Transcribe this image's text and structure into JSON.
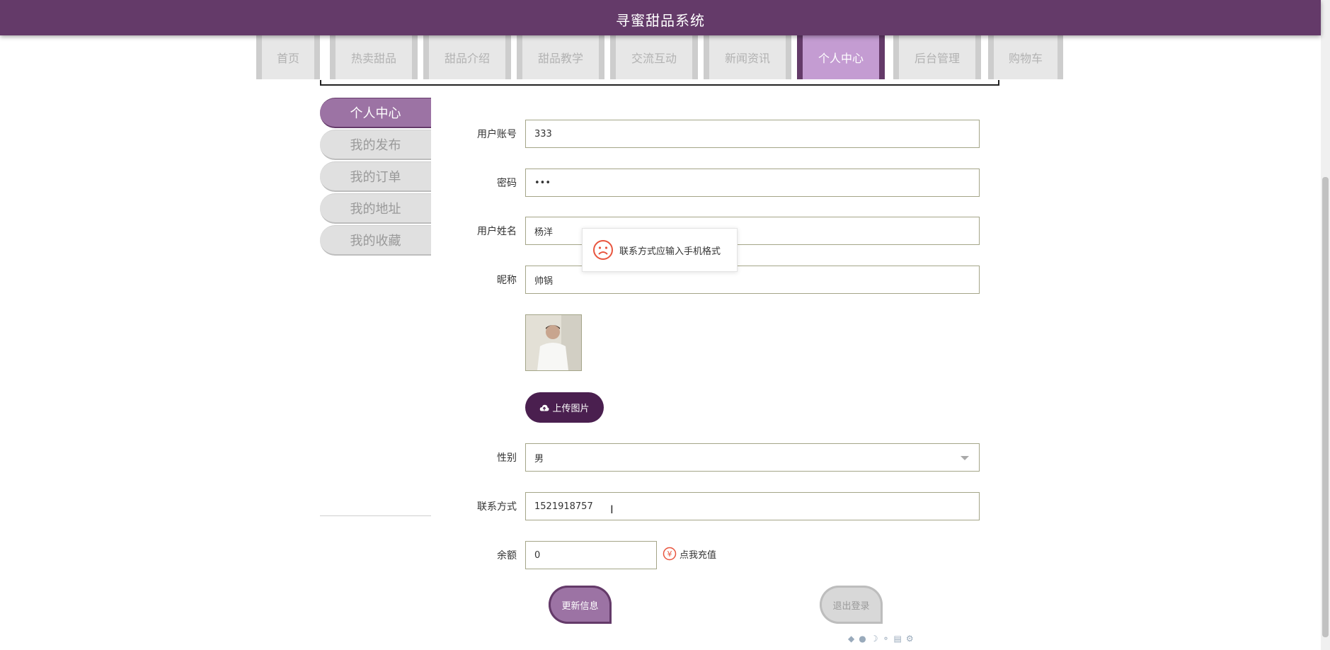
{
  "app": {
    "title": "寻蜜甜品系统"
  },
  "nav": {
    "tabs": [
      {
        "label": "首页"
      },
      {
        "label": "热卖甜品"
      },
      {
        "label": "甜品介绍"
      },
      {
        "label": "甜品教学"
      },
      {
        "label": "交流互动"
      },
      {
        "label": "新闻资讯"
      },
      {
        "label": "个人中心",
        "active": true
      },
      {
        "label": "后台管理"
      },
      {
        "label": "购物车"
      }
    ]
  },
  "sidebar": {
    "items": [
      {
        "label": "个人中心",
        "active": true
      },
      {
        "label": "我的发布"
      },
      {
        "label": "我的订单"
      },
      {
        "label": "我的地址"
      },
      {
        "label": "我的收藏"
      }
    ]
  },
  "form": {
    "account_label": "用户账号",
    "account_value": "333",
    "password_label": "密码",
    "password_value": "•••",
    "name_label": "用户姓名",
    "name_value": "杨洋",
    "nickname_label": "昵称",
    "nickname_value": "帅锅",
    "upload_label": "上传图片",
    "gender_label": "性别",
    "gender_value": "男",
    "phone_label": "联系方式",
    "phone_value": "1521918757",
    "balance_label": "余额",
    "balance_value": "0",
    "recharge_label": "点我充值",
    "update_label": "更新信息",
    "logout_label": "退出登录"
  },
  "toast": {
    "message": "联系方式应输入手机格式"
  },
  "colors": {
    "primary": "#643a69",
    "accent": "#c49cd2",
    "button_dark": "#4a1f4f"
  }
}
